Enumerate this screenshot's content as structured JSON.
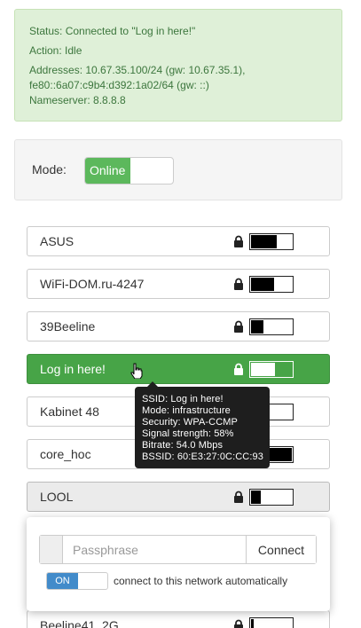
{
  "status": {
    "status_line": "Status: Connected to \"Log in here!\"",
    "action_line": "Action: Idle",
    "addresses_line1": "Addresses: 10.67.35.100/24 (gw: 10.67.35.1),",
    "addresses_line2": "fe80::6a07:c9b4:d392:1a02/64 (gw: ::)",
    "nameserver_line": "Nameserver: 8.8.8.8"
  },
  "mode": {
    "label": "Mode:",
    "switch_on_label": "Online"
  },
  "networks": [
    {
      "ssid": "ASUS",
      "secured": true,
      "signal_fraction": 0.6
    },
    {
      "ssid": "WiFi-DOM.ru-4247",
      "secured": true,
      "signal_fraction": 0.55
    },
    {
      "ssid": "39Beeline",
      "secured": true,
      "signal_fraction": 0.3
    },
    {
      "ssid": "Log in here!",
      "secured": true,
      "signal_fraction": 0.58,
      "active": true
    },
    {
      "ssid": "Kabinet 48",
      "secured": true,
      "signal_fraction": 0.2
    },
    {
      "ssid": "core_hoc",
      "secured": true,
      "signal_fraction": 0.45
    },
    {
      "ssid": "LOOL",
      "secured": true,
      "signal_fraction": 0.25,
      "selected": true
    },
    {
      "ssid": "Beeline41_2G",
      "secured": true,
      "signal_fraction": 0.05
    }
  ],
  "tooltip": {
    "ssid": "SSID: Log in here!",
    "mode": "Mode: infrastructure",
    "security": "Security: WPA-CCMP",
    "signal": "Signal strength: 58%",
    "bitrate": "Bitrate: 54.0 Mbps",
    "bssid": "BSSID: 60:E3:27:0C:CC:93"
  },
  "connect_popup": {
    "passphrase_placeholder": "Passphrase",
    "connect_label": "Connect",
    "auto_switch_label": "ON",
    "auto_connect_label": "connect to this network automatically"
  },
  "icons": {
    "lock": "lock-icon",
    "cursor": "hand-cursor-icon"
  },
  "colors": {
    "status_bg": "#dff0d8",
    "status_text": "#3c763d",
    "online_green": "#5cb85c",
    "active_row": "#47a447",
    "toggle_blue": "#428bca"
  }
}
